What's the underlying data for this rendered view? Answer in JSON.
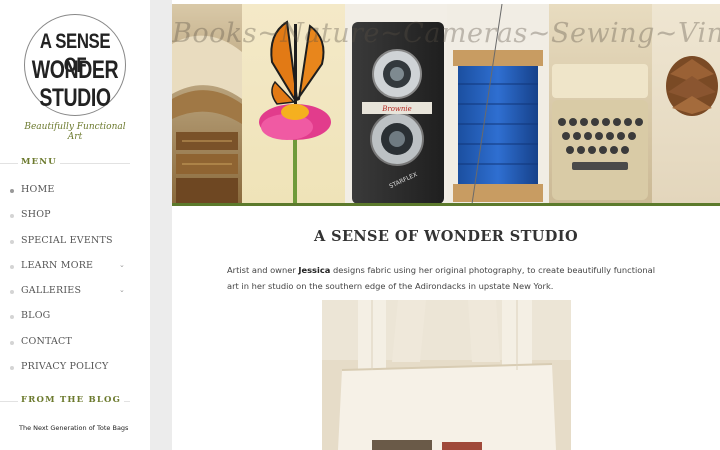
{
  "site": {
    "logo_lines": [
      "A SENSE OF",
      "WONDER",
      "STUDIO"
    ],
    "tagline": "Beautifully Functional Art"
  },
  "sidebar": {
    "menu_heading": "MENU",
    "menu_items": [
      {
        "label": "HOME",
        "has_submenu": false,
        "active": true
      },
      {
        "label": "SHOP",
        "has_submenu": false,
        "active": false
      },
      {
        "label": "SPECIAL EVENTS",
        "has_submenu": false,
        "active": false
      },
      {
        "label": "LEARN MORE",
        "has_submenu": true,
        "active": false
      },
      {
        "label": "GALLERIES",
        "has_submenu": true,
        "active": false
      },
      {
        "label": "BLOG",
        "has_submenu": false,
        "active": false
      },
      {
        "label": "CONTACT",
        "has_submenu": false,
        "active": false
      },
      {
        "label": "PRIVACY POLICY",
        "has_submenu": false,
        "active": false
      }
    ],
    "blog_heading": "FROM THE BLOG",
    "blog_posts": [
      "The Next Generation of Tote Bags"
    ]
  },
  "banner": {
    "overlay_text": "Books~Nature~Cameras~Sewing~Vintage~Treasures",
    "camera_brand": "Brownie",
    "camera_model": "STARFLEX",
    "accent_color": "#5c7a2c"
  },
  "main": {
    "title": "A SENSE OF WONDER STUDIO",
    "intro_before": "Artist and owner ",
    "intro_name": "Jessica",
    "intro_after": " designs fabric using her original photography, to create beautifully functional art in her studio on the southern edge of the Adirondacks in upstate New York."
  },
  "colors": {
    "accent": "#6c7a2e",
    "background": "#ececec"
  }
}
